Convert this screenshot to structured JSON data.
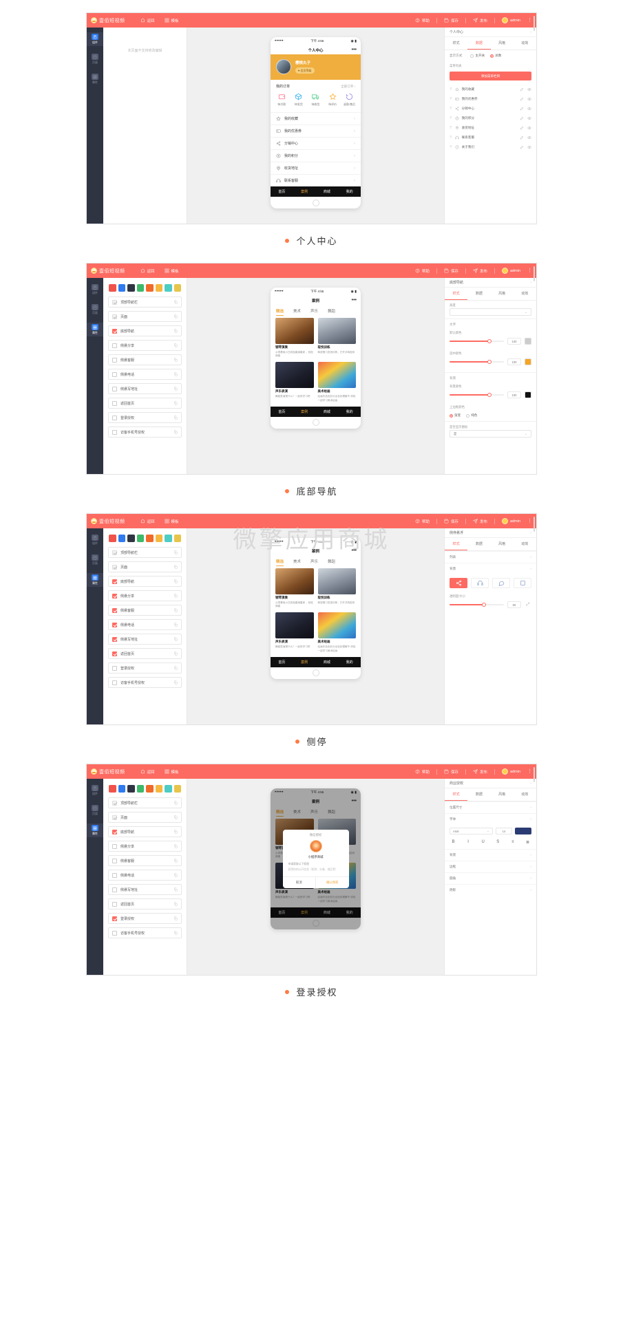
{
  "watermark": "微擎应用商城",
  "app": {
    "brand": "壹佰短视频",
    "nav": [
      {
        "label": "返回",
        "icon": "home-icon"
      },
      {
        "label": "模板",
        "icon": "grid-icon"
      }
    ],
    "right": [
      {
        "label": "帮助",
        "icon": "question-icon"
      },
      {
        "label": "保存",
        "icon": "save-icon"
      },
      {
        "label": "发布",
        "icon": "send-icon"
      }
    ],
    "user": "admin",
    "kebab": "⋮"
  },
  "rail": {
    "items": [
      {
        "label": "组件",
        "icon": "component-icon"
      },
      {
        "label": "页面",
        "icon": "page-icon"
      },
      {
        "label": "属性",
        "icon": "properties-icon"
      }
    ]
  },
  "panels": [
    {
      "caption": "个人中心",
      "rail_active": 0,
      "outline": {
        "empty_text": "本页面不支持修改编辑"
      },
      "phone": {
        "status": {
          "signal": "•••••",
          "time": "下午 4:55",
          "battery": "◉ ▮"
        },
        "title": "个人中心",
        "profile": {
          "name": "樱桃丸子",
          "badge": "♥ 会员等级"
        },
        "order": {
          "title": "我的订单",
          "more": "全部订单 ›"
        },
        "order_items": [
          {
            "label": "待付款",
            "icon": "wallet-icon",
            "color": "#ff7f9c"
          },
          {
            "label": "待发货",
            "icon": "box-icon",
            "color": "#4ab8f0"
          },
          {
            "label": "待收货",
            "icon": "truck-icon",
            "color": "#6bd49a"
          },
          {
            "label": "待评价",
            "icon": "star-icon",
            "color": "#ffb84d"
          },
          {
            "label": "退款/售后",
            "icon": "refund-icon",
            "color": "#a08cf0"
          }
        ],
        "menu": [
          {
            "label": "我的收藏",
            "icon": "star-outline-icon"
          },
          {
            "label": "我的优惠券",
            "icon": "coupon-icon"
          },
          {
            "label": "分销中心",
            "icon": "share-icon"
          },
          {
            "label": "我的积分",
            "icon": "coin-icon"
          },
          {
            "label": "收货地址",
            "icon": "location-icon"
          },
          {
            "label": "联系客服",
            "icon": "headset-icon"
          }
        ],
        "tabbar": [
          {
            "label": "首页",
            "selected": false
          },
          {
            "label": "案例",
            "selected": true
          },
          {
            "label": "商城",
            "selected": false
          },
          {
            "label": "我的",
            "selected": false
          }
        ]
      },
      "inspector": {
        "section": "个人中心",
        "tabs": [
          {
            "label": "样式",
            "selected": false
          },
          {
            "label": "数据",
            "selected": true
          },
          {
            "label": "风格",
            "selected": false
          },
          {
            "label": "动效",
            "selected": false
          }
        ],
        "display_label": "显示方式",
        "display_options": [
          {
            "label": "主开关",
            "on": false
          },
          {
            "label": "总数",
            "on": true
          }
        ],
        "list_label": "菜单列表",
        "add_button": "添加菜单栏目",
        "menu_rows": [
          {
            "label": "我的收藏",
            "icon": "star-outline-icon"
          },
          {
            "label": "我的优惠券",
            "icon": "coupon-icon"
          },
          {
            "label": "分销中心",
            "icon": "share-icon"
          },
          {
            "label": "我的积分",
            "icon": "coin-icon"
          },
          {
            "label": "收货地址",
            "icon": "location-icon"
          },
          {
            "label": "联系客服",
            "icon": "headset-icon"
          },
          {
            "label": "关于我们",
            "icon": "info-icon"
          }
        ]
      }
    },
    {
      "caption": "底部导航",
      "rail_active": 2,
      "swatches": [
        "#f0534a",
        "#2f7bef",
        "#2f3443",
        "#3eb96a",
        "#f06a2a",
        "#f5b942",
        "#4ecdc4",
        "#e8c44a"
      ],
      "layers": [
        {
          "label": "顶部导航栏",
          "state": "grey"
        },
        {
          "label": "页面",
          "state": "grey"
        },
        {
          "label": "底部导航",
          "state": "checked"
        },
        {
          "label": "侧悬分享",
          "state": "off"
        },
        {
          "label": "侧悬客服",
          "state": "off"
        },
        {
          "label": "侧悬电话",
          "state": "off"
        },
        {
          "label": "侧悬写地址",
          "state": "off"
        },
        {
          "label": "返回首页",
          "state": "off"
        },
        {
          "label": "登录授权",
          "state": "off"
        },
        {
          "label": "访客手机号授权",
          "state": "off"
        }
      ],
      "phone": {
        "status": {
          "signal": "•••••",
          "time": "下午 4:55",
          "battery": "◉ ▮"
        },
        "title": "案例",
        "tabs": [
          {
            "label": "精选",
            "selected": true
          },
          {
            "label": "美术",
            "selected": false
          },
          {
            "label": "声乐",
            "selected": false
          },
          {
            "label": "舞蹈",
            "selected": false
          }
        ],
        "cards": [
          {
            "title": "钢琴演奏",
            "desc": "从零基础小白到独奏演奏家 ，轻松弹奏",
            "thumb": "piano"
          },
          {
            "title": "取悦训练",
            "desc": "释放唱习发音训练，打开共鸣腔体",
            "thumb": "training"
          },
          {
            "title": "声乐表演",
            "desc": "舞蹈表演是什么？一起来学习吧",
            "thumb": "concert"
          },
          {
            "title": "美术绘画",
            "desc": "绘画作品色彩分出色彩理解不 体验一起学习美术绘画",
            "thumb": "art"
          }
        ],
        "tabbar": [
          {
            "label": "首页",
            "selected": false
          },
          {
            "label": "案例",
            "selected": true
          },
          {
            "label": "商城",
            "selected": false
          },
          {
            "label": "我的",
            "selected": false
          }
        ]
      },
      "inspector": {
        "section": "底部导航",
        "tabs": [
          {
            "label": "样式",
            "selected": true
          },
          {
            "label": "数据",
            "selected": false
          },
          {
            "label": "风格",
            "selected": false
          },
          {
            "label": "动效",
            "selected": false
          }
        ],
        "groups": [
          {
            "label": "高度",
            "type": "select",
            "value": ""
          },
          {
            "label": "文字",
            "type": "header"
          },
          {
            "label": "默认颜色",
            "type": "slider",
            "value": "100",
            "color": "#cccccc"
          },
          {
            "label": "选中颜色",
            "type": "slider",
            "value": "100",
            "color": "#f5a623"
          },
          {
            "label": "背景",
            "type": "header"
          },
          {
            "label": "背景颜色",
            "type": "slider",
            "value": "100",
            "color": "#111111"
          },
          {
            "label": "上边框颜色",
            "type": "radio",
            "options": [
              "渐变",
              "纯色"
            ]
          },
          {
            "label": "是否显示图标",
            "type": "switch",
            "value": "是"
          }
        ]
      }
    },
    {
      "caption": "侧停",
      "rail_active": 2,
      "swatches": [
        "#f0534a",
        "#2f7bef",
        "#2f3443",
        "#3eb96a",
        "#f06a2a",
        "#f5b942",
        "#4ecdc4",
        "#e8c44a"
      ],
      "layers": [
        {
          "label": "顶部导航栏",
          "state": "grey"
        },
        {
          "label": "页面",
          "state": "grey"
        },
        {
          "label": "底部导航",
          "state": "checked"
        },
        {
          "label": "侧悬分享",
          "state": "checked"
        },
        {
          "label": "侧悬客服",
          "state": "checked"
        },
        {
          "label": "侧悬电话",
          "state": "checked"
        },
        {
          "label": "侧悬写地址",
          "state": "checked"
        },
        {
          "label": "返回首页",
          "state": "checked"
        },
        {
          "label": "登录授权",
          "state": "off"
        },
        {
          "label": "访客手机号授权",
          "state": "off"
        }
      ],
      "phone": {
        "status": {
          "signal": "•••••",
          "time": "下午 4:55",
          "battery": "◉ ▮"
        },
        "title": "案例",
        "tabs": [
          {
            "label": "精选",
            "selected": true
          },
          {
            "label": "美术",
            "selected": false
          },
          {
            "label": "声乐",
            "selected": false
          },
          {
            "label": "舞蹈",
            "selected": false
          }
        ],
        "cards": [
          {
            "title": "钢琴演奏",
            "desc": "从零基础小白到独奏演奏家 ，轻松弹奏",
            "thumb": "piano"
          },
          {
            "title": "取悦训练",
            "desc": "释放唱习发音训练，打开共鸣腔体",
            "thumb": "training"
          },
          {
            "title": "声乐表演",
            "desc": "舞蹈表演是什么？一起来学习吧",
            "thumb": "concert"
          },
          {
            "title": "美术绘画",
            "desc": "绘画作品色彩分出色彩理解不 体验一起学习美术绘画",
            "thumb": "art"
          }
        ],
        "tabbar": [
          {
            "label": "首页",
            "selected": false
          },
          {
            "label": "案例",
            "selected": true
          },
          {
            "label": "商城",
            "selected": false
          },
          {
            "label": "我的",
            "selected": false
          }
        ]
      },
      "inspector": {
        "section": "侧停悬浮",
        "tabs": [
          {
            "label": "样式",
            "selected": true
          },
          {
            "label": "数据",
            "selected": false
          },
          {
            "label": "风格",
            "selected": false
          },
          {
            "label": "动效",
            "selected": false
          }
        ],
        "rows": [
          {
            "label": "列表"
          },
          {
            "label": "背景"
          }
        ],
        "tools": [
          {
            "icon": "share-icon",
            "selected": true
          },
          {
            "icon": "headset-icon",
            "selected": false
          },
          {
            "icon": "message-icon",
            "selected": false
          },
          {
            "icon": "blank-icon",
            "selected": false
          }
        ],
        "opacity_label": "透明度/大小",
        "opacity_value": "50"
      }
    },
    {
      "caption": "登录授权",
      "rail_active": 2,
      "swatches": [
        "#f0534a",
        "#2f7bef",
        "#2f3443",
        "#3eb96a",
        "#f06a2a",
        "#f5b942",
        "#4ecdc4",
        "#e8c44a"
      ],
      "layers": [
        {
          "label": "顶部导航栏",
          "state": "grey"
        },
        {
          "label": "页面",
          "state": "grey"
        },
        {
          "label": "底部导航",
          "state": "checked"
        },
        {
          "label": "侧悬分享",
          "state": "off"
        },
        {
          "label": "侧悬客服",
          "state": "off"
        },
        {
          "label": "侧悬电话",
          "state": "off"
        },
        {
          "label": "侧悬写地址",
          "state": "off"
        },
        {
          "label": "返回首页",
          "state": "off"
        },
        {
          "label": "登录授权",
          "state": "checked"
        },
        {
          "label": "访客手机号授权",
          "state": "off"
        }
      ],
      "phone": {
        "status": {
          "signal": "•••••",
          "time": "下午 4:55",
          "battery": "◉ ▮"
        },
        "title": "案例",
        "tabs": [
          {
            "label": "精选",
            "selected": true
          },
          {
            "label": "美术",
            "selected": false
          },
          {
            "label": "声乐",
            "selected": false
          },
          {
            "label": "舞蹈",
            "selected": false
          }
        ],
        "cards": [
          {
            "title": "钢琴演奏",
            "desc": "从零基础小白到独奏演奏家 ，轻松弹奏",
            "thumb": "piano"
          },
          {
            "title": "取悦训练",
            "desc": "释放唱习发音训练，打开共鸣腔体",
            "thumb": "training"
          },
          {
            "title": "声乐表演",
            "desc": "舞蹈表演是什么？一起来学习吧",
            "thumb": "concert"
          },
          {
            "title": "美术绘画",
            "desc": "绘画作品色彩分出色彩理解不 体验一起学习美术绘画",
            "thumb": "art"
          }
        ],
        "tabbar": [
          {
            "label": "首页",
            "selected": false
          },
          {
            "label": "案例",
            "selected": true
          },
          {
            "label": "商城",
            "selected": false
          },
          {
            "label": "我的",
            "selected": false
          }
        ],
        "modal": {
          "title": "微信授权",
          "app_name": "小程序商城",
          "line1": "申请获取以下权限",
          "line2": "获得你的公开信息（昵称、头像、地区等）",
          "cancel": "取消",
          "confirm": "确认授权"
        }
      },
      "inspector": {
        "section": "商业授权",
        "tabs": [
          {
            "label": "样式",
            "selected": true
          },
          {
            "label": "数据",
            "selected": false
          },
          {
            "label": "风格",
            "selected": false
          },
          {
            "label": "动效",
            "selected": false
          }
        ],
        "size_label": "位置尺寸",
        "font_label": "字体",
        "font_family": "Arial",
        "font_size": "14",
        "font_color": "#2a3c73",
        "format_icons": [
          "B",
          "I",
          "U",
          "S",
          "≡",
          "≣"
        ],
        "rows": [
          {
            "label": "背景"
          },
          {
            "label": "边框"
          },
          {
            "label": "圆角"
          },
          {
            "label": "阴影"
          }
        ]
      }
    }
  ]
}
